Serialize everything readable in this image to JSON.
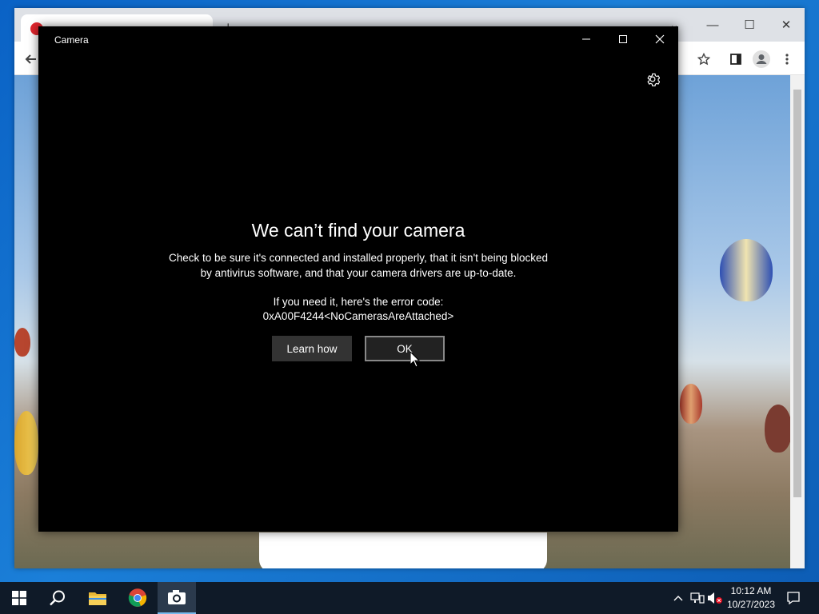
{
  "camera_window": {
    "title": "Camera",
    "controls": {
      "minimize": "—",
      "maximize": "☐",
      "close": "✕"
    },
    "settings_icon": "gear-icon"
  },
  "error_dialog": {
    "title": "We can’t find your camera",
    "body_line1": "Check to be sure it's connected and installed properly, that it isn't being blocked",
    "body_line2": "by antivirus software, and that your camera drivers are up-to-date.",
    "code_label": "If you need it, here's the error code:",
    "code_value": "0xA00F4244<NoCamerasAreAttached>",
    "learn_button": "Learn how",
    "ok_button": "OK"
  },
  "browser": {
    "tab_new": "+",
    "controls": {
      "minimize": "—",
      "maximize": "☐",
      "close": "✕",
      "tabsearch": "⌄"
    },
    "toolbar_icons": [
      "back-icon",
      "star-icon",
      "sidepanel-icon",
      "profile-icon",
      "menu-icon"
    ]
  },
  "taskbar": {
    "apps": [
      "start-icon",
      "search-icon",
      "file-explorer-icon",
      "chrome-icon",
      "camera-icon"
    ],
    "clock_time": "10:12 AM",
    "clock_date": "10/27/2023"
  },
  "colors": {
    "taskbar_bg": "#0f1a28",
    "camera_bg": "#000000",
    "accent": "#76b9ed"
  }
}
